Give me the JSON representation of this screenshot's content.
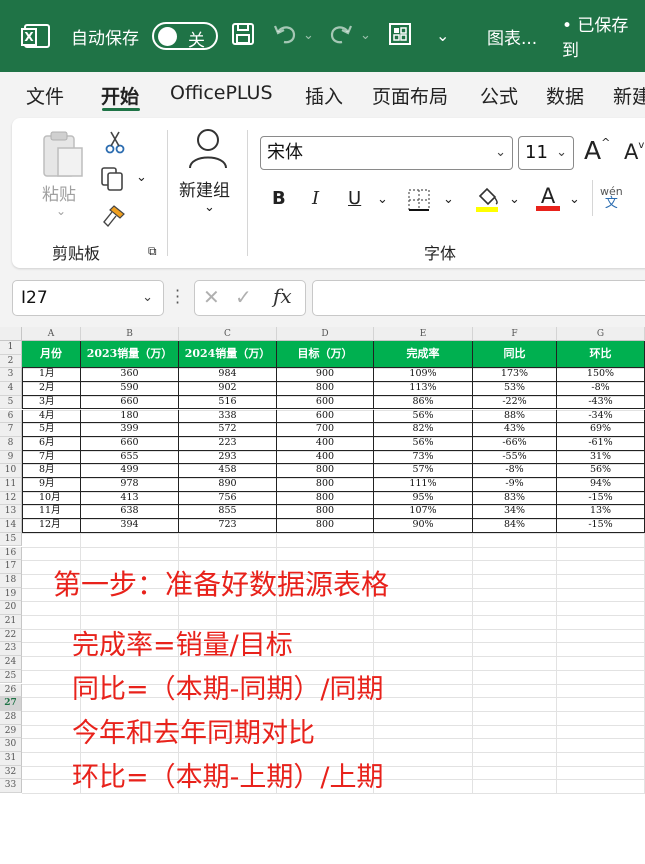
{
  "titlebar": {
    "autosave_label": "自动保存",
    "toggle_label": "关",
    "chart_menu": "图表...",
    "saved_status": "• 已保存到"
  },
  "tabs": [
    "文件",
    "开始",
    "OfficePLUS",
    "插入",
    "页面布局",
    "公式",
    "数据",
    "新建"
  ],
  "active_tab": "开始",
  "ribbon": {
    "paste_label": "粘贴",
    "clipboard_group": "剪贴板",
    "new_group_label": "新建组",
    "font_name": "宋体",
    "font_size": "11",
    "font_group": "字体",
    "bold": "B",
    "italic": "I",
    "underline": "U",
    "grow_font": "A",
    "shrink_font": "A",
    "font_color_letter": "A",
    "phonetic_top": "wén",
    "phonetic_bottom": "文"
  },
  "formula_bar": {
    "name_box": "I27",
    "fx": "fx",
    "value": ""
  },
  "colors": {
    "excel_green": "#1f7346",
    "header_fill": "#00b050",
    "note_red": "#e8221b",
    "font_color_bar": "#e8221b",
    "fill_color_bar": "#ffff00"
  },
  "sheet": {
    "column_letters": [
      "A",
      "B",
      "C",
      "D",
      "E",
      "F",
      "G"
    ],
    "headers": [
      "月份",
      "2023销量（万）",
      "2024销量（万）",
      "目标（万）",
      "完成率",
      "同比",
      "环比"
    ],
    "rows": [
      [
        "1月",
        "360",
        "984",
        "900",
        "109%",
        "173%",
        "150%"
      ],
      [
        "2月",
        "590",
        "902",
        "800",
        "113%",
        "53%",
        "-8%"
      ],
      [
        "3月",
        "660",
        "516",
        "600",
        "86%",
        "-22%",
        "-43%"
      ],
      [
        "4月",
        "180",
        "338",
        "600",
        "56%",
        "88%",
        "-34%"
      ],
      [
        "5月",
        "399",
        "572",
        "700",
        "82%",
        "43%",
        "69%"
      ],
      [
        "6月",
        "660",
        "223",
        "400",
        "56%",
        "-66%",
        "-61%"
      ],
      [
        "7月",
        "655",
        "293",
        "400",
        "73%",
        "-55%",
        "31%"
      ],
      [
        "8月",
        "499",
        "458",
        "800",
        "57%",
        "-8%",
        "56%"
      ],
      [
        "9月",
        "978",
        "890",
        "800",
        "111%",
        "-9%",
        "94%"
      ],
      [
        "10月",
        "413",
        "756",
        "800",
        "95%",
        "83%",
        "-15%"
      ],
      [
        "11月",
        "638",
        "855",
        "800",
        "107%",
        "34%",
        "13%"
      ],
      [
        "12月",
        "394",
        "723",
        "800",
        "90%",
        "84%",
        "-15%"
      ]
    ],
    "row_numbers": [
      "1",
      "2",
      "3",
      "4",
      "5",
      "6",
      "7",
      "8",
      "9",
      "10",
      "11",
      "12",
      "13",
      "14",
      "15",
      "16",
      "17",
      "18",
      "19",
      "20",
      "21",
      "22",
      "23",
      "24",
      "25",
      "26",
      "27",
      "28",
      "29",
      "30",
      "31",
      "32",
      "33"
    ],
    "selected_row": "27"
  },
  "notes": {
    "step1": "第一步：准备好数据源表格",
    "line1": "完成率=销量/目标",
    "line2": "同比=（本期-同期）/同期",
    "line3": "今年和去年同期对比",
    "line4": "环比=（本期-上期）/上期"
  }
}
